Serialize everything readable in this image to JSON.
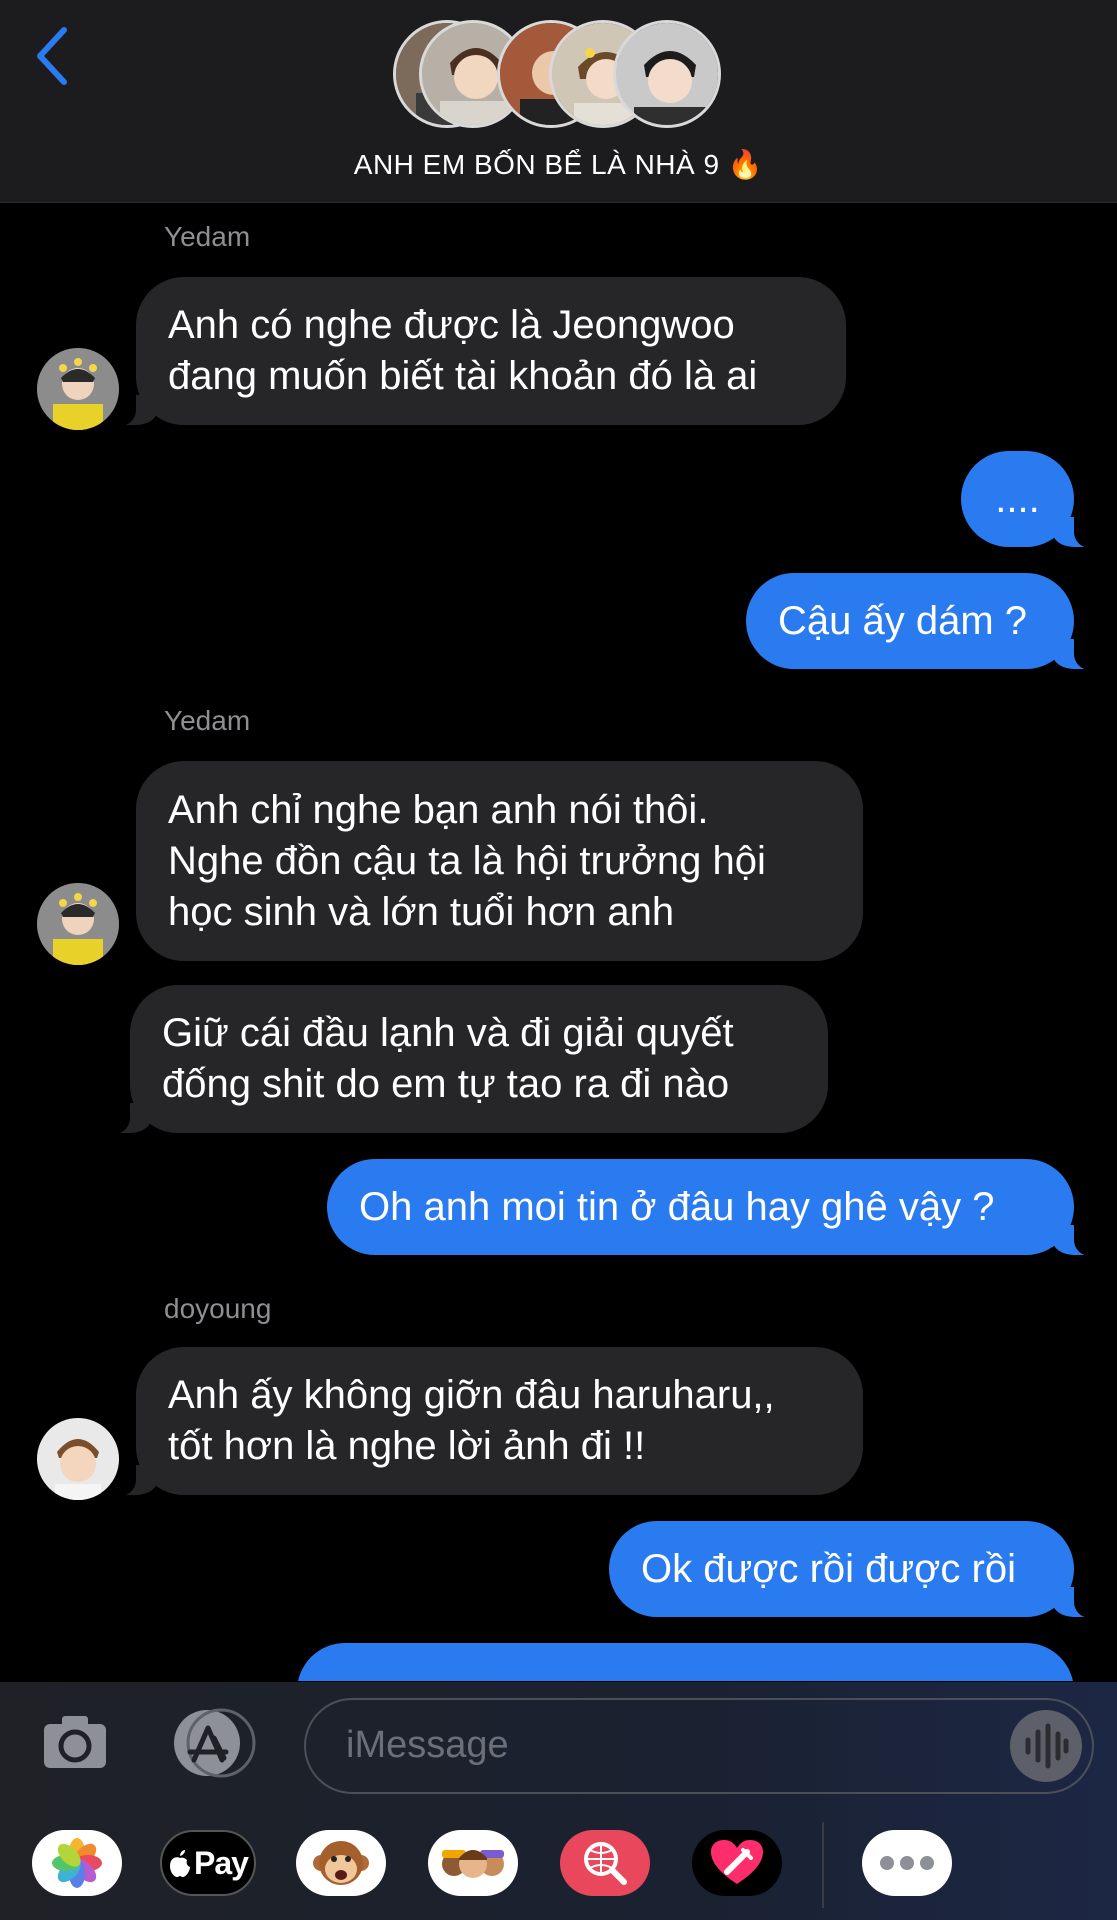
{
  "header": {
    "back_icon": "chevron-left-icon",
    "title": "ANH EM BỐN BỂ LÀ NHÀ 9",
    "title_emoji": "🔥",
    "accent_color": "#2b7bf0"
  },
  "messages": [
    {
      "sender": "Yedam",
      "direction": "incoming",
      "text": "Anh có nghe được là Jeongwoo\nđang muốn biết tài khoản đó là ai"
    },
    {
      "direction": "outgoing",
      "text": "...."
    },
    {
      "direction": "outgoing",
      "text": "Cậu ấy dám ?"
    },
    {
      "sender": "Yedam",
      "direction": "incoming",
      "text": "Anh chỉ nghe bạn anh nói thôi.\nNghe đồn cậu ta là hội trưởng hội\nhọc sinh và lớn tuổi hơn anh"
    },
    {
      "direction": "incoming",
      "text": "Giữ cái đầu lạnh và đi giải quyết\nđống shit do em tự tao ra đi nào"
    },
    {
      "direction": "outgoing",
      "text": "Oh anh moi tin ở đâu hay ghê vậy ?"
    },
    {
      "sender": "doyoung",
      "direction": "incoming",
      "text": "Anh ấy không giỡn đâu haruharu,,\ntốt hơn là nghe lời ảnh đi !!"
    },
    {
      "direction": "outgoing",
      "text": "Ok được rồi được rồi"
    }
  ],
  "input": {
    "placeholder": "iMessage",
    "camera_icon": "camera-icon",
    "appstore_icon": "app-store-icon",
    "voice_icon": "waveform-icon"
  },
  "app_tray": {
    "apple_pay_label": "Pay",
    "apps": [
      "photos-icon",
      "apple-pay-icon",
      "monkey-animoji-icon",
      "memoji-icon",
      "web-search-icon",
      "digital-touch-icon",
      "more-icon"
    ]
  }
}
